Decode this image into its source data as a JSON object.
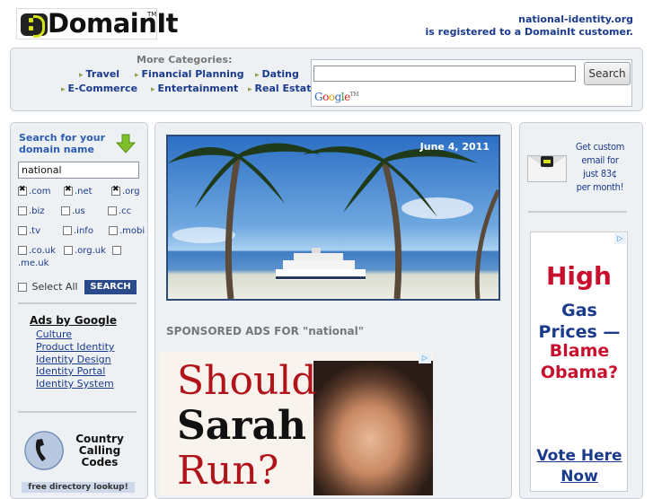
{
  "header": {
    "logo_text": "DomainIt",
    "logo_tm": "TM",
    "domain_name": "national-identity.org",
    "registered_text": "is registered to a DomainIt customer."
  },
  "categories": {
    "title": "More Categories:",
    "items": [
      "Travel",
      "Financial Planning",
      "Dating",
      "E-Commerce",
      "Entertainment",
      "Real Estate"
    ]
  },
  "search": {
    "input_value": "",
    "button_label": "Search",
    "google_letters": [
      "G",
      "o",
      "o",
      "g",
      "l",
      "e"
    ],
    "google_tm": "TM"
  },
  "sidebar": {
    "search_title": "Search for your domain name",
    "input_value": "national",
    "tlds": [
      {
        "label": ".com",
        "checked": true
      },
      {
        "label": ".net",
        "checked": true
      },
      {
        "label": ".org",
        "checked": true
      },
      {
        "label": ".biz",
        "checked": false
      },
      {
        "label": ".us",
        "checked": false
      },
      {
        "label": ".cc",
        "checked": false
      },
      {
        "label": ".tv",
        "checked": false
      },
      {
        "label": ".info",
        "checked": false
      },
      {
        "label": ".mobi",
        "checked": false
      },
      {
        "label": ".co.uk",
        "checked": false
      },
      {
        "label": ".org.uk",
        "checked": false
      },
      {
        "label": ".me.uk",
        "checked": false
      }
    ],
    "select_all_label": "Select All",
    "search_button_label": "SEARCH",
    "ads_title": "Ads by Google",
    "ad_links": [
      "Culture",
      "Product Identity",
      "Identity Design",
      "Identity Portal",
      "Identity System"
    ],
    "country_codes_text": [
      "Country",
      "Calling",
      "Codes"
    ],
    "free_directory_text": "free directory lookup!"
  },
  "main": {
    "hero_date": "June 4, 2011",
    "sponsored_text": "SPONSORED ADS FOR \"national\"",
    "sarah_ad": {
      "line1": "Should",
      "line2": "Sarah",
      "line3": "Run?"
    }
  },
  "right": {
    "email_promo": [
      "Get custom",
      "email for",
      "just 83¢",
      "per month!"
    ],
    "gas_ad": {
      "high": "High",
      "gas_prices": "Gas Prices —",
      "blame": "Blame Obama?",
      "vote": "Vote Here Now"
    }
  },
  "colors": {
    "link": "#1a3a8c",
    "brand_yellow": "#d7e31a",
    "ad_red": "#c8102e",
    "panel_bg": "#eef1f4"
  }
}
